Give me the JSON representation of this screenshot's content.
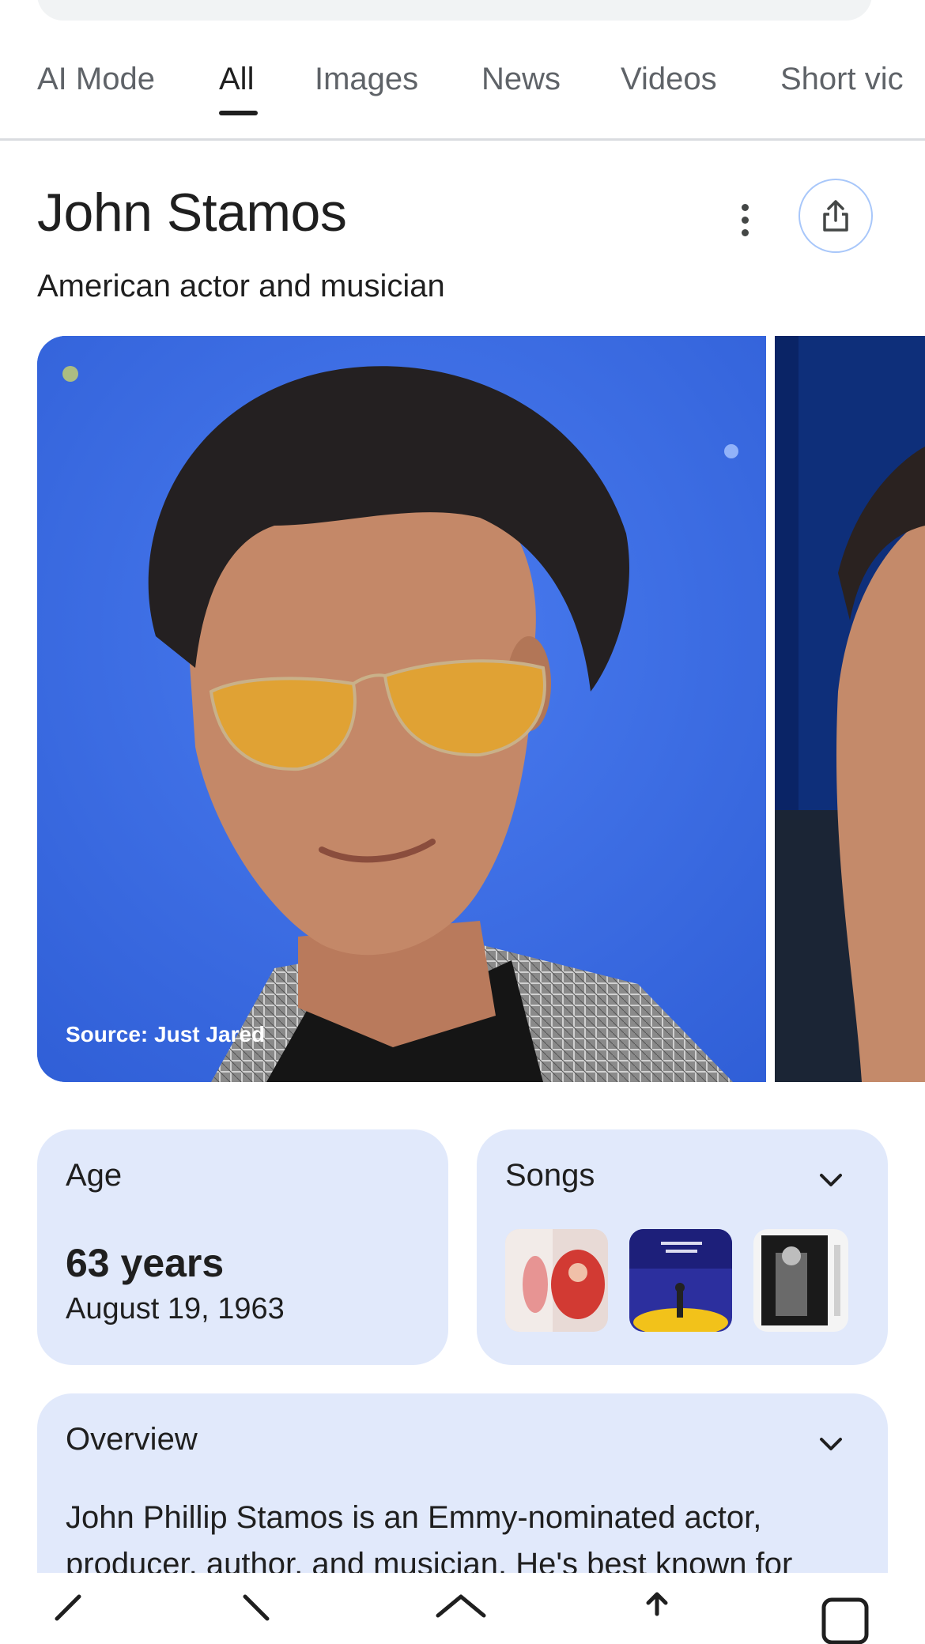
{
  "tabs": [
    {
      "label": "AI Mode",
      "active": false
    },
    {
      "label": "All",
      "active": true
    },
    {
      "label": "Images",
      "active": false
    },
    {
      "label": "News",
      "active": false
    },
    {
      "label": "Videos",
      "active": false
    },
    {
      "label": "Short vic",
      "active": false
    }
  ],
  "entity": {
    "title": "John Stamos",
    "subtitle": "American actor and musician"
  },
  "photo": {
    "source": "Source: Just Jared"
  },
  "age_card": {
    "label": "Age",
    "value": "63 years",
    "date": "August 19, 1963"
  },
  "songs_card": {
    "label": "Songs",
    "thumbnails": [
      "song-thumbnail-1",
      "song-thumbnail-2",
      "song-thumbnail-3"
    ]
  },
  "overview": {
    "label": "Overview",
    "text": "John Phillip Stamos is an Emmy-nominated actor, producer, author, and musician. He's best known for"
  },
  "colors": {
    "card_bg": "#e1e9fb",
    "share_border": "#a8c7fa",
    "photo_bg": "#3b6fe0",
    "tab_inactive": "#5f6368"
  },
  "icons": {
    "more": "more-vert-icon",
    "share": "share-icon",
    "expand": "chevron-down-icon",
    "nav": [
      "back-icon",
      "forward-icon",
      "home-icon",
      "share-icon",
      "tabs-icon"
    ]
  }
}
